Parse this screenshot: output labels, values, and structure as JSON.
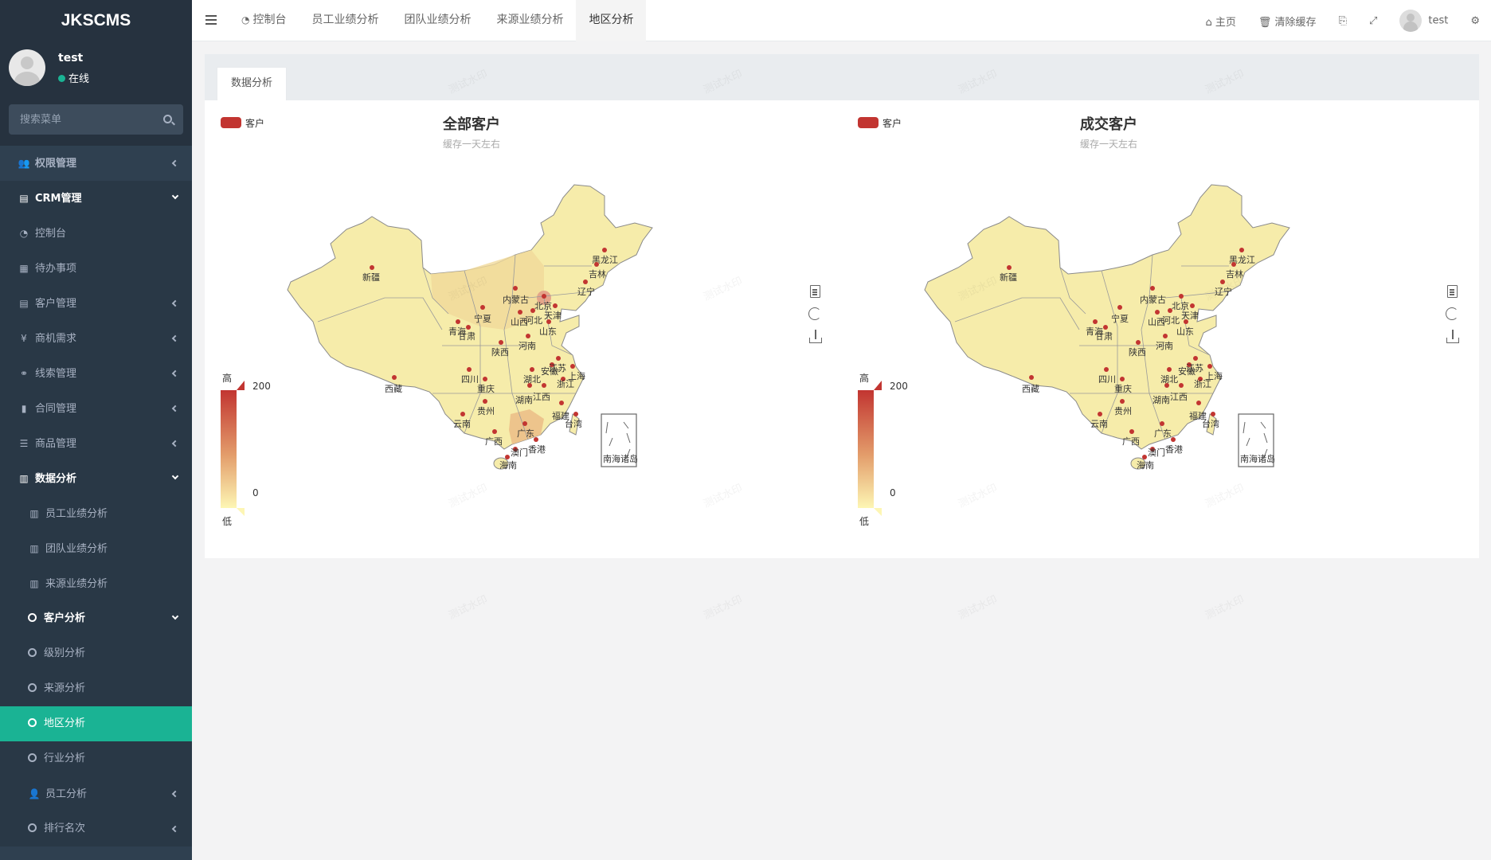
{
  "sidebar": {
    "brand": "JKSCMS",
    "user": {
      "name": "test",
      "status": "在线"
    },
    "search_placeholder": "搜索菜单",
    "items": [
      {
        "label": "权限管理",
        "icon": "users-icon",
        "glyph": "👥",
        "arrow": "left",
        "type": "top"
      },
      {
        "label": "CRM管理",
        "icon": "id-card-icon",
        "glyph": "▤",
        "arrow": "down",
        "type": "open"
      },
      {
        "label": "控制台",
        "icon": "dashboard-icon",
        "glyph": "◔",
        "arrow": "",
        "type": "sub"
      },
      {
        "label": "待办事项",
        "icon": "calendar-check-icon",
        "glyph": "▦",
        "arrow": "",
        "type": "sub"
      },
      {
        "label": "客户管理",
        "icon": "address-card-icon",
        "glyph": "▤",
        "arrow": "left",
        "type": "sub"
      },
      {
        "label": "商机需求",
        "icon": "yen-icon",
        "glyph": "¥",
        "arrow": "left",
        "type": "sub"
      },
      {
        "label": "线索管理",
        "icon": "link-icon",
        "glyph": "⚭",
        "arrow": "left",
        "type": "sub"
      },
      {
        "label": "合同管理",
        "icon": "bookmark-icon",
        "glyph": "▮",
        "arrow": "left",
        "type": "sub"
      },
      {
        "label": "商品管理",
        "icon": "list-icon",
        "glyph": "☰",
        "arrow": "left",
        "type": "sub"
      },
      {
        "label": "数据分析",
        "icon": "bar-chart-icon",
        "glyph": "▥",
        "arrow": "down",
        "type": "sub-white"
      },
      {
        "label": "员工业绩分析",
        "icon": "bar-chart-icon",
        "glyph": "▥",
        "arrow": "",
        "type": "sub2"
      },
      {
        "label": "团队业绩分析",
        "icon": "bar-chart-icon",
        "glyph": "▥",
        "arrow": "",
        "type": "sub2"
      },
      {
        "label": "来源业绩分析",
        "icon": "bar-chart-icon",
        "glyph": "▥",
        "arrow": "",
        "type": "sub2"
      },
      {
        "label": "客户分析",
        "icon": "circle-icon",
        "glyph": "",
        "arrow": "down",
        "type": "sub2-white"
      },
      {
        "label": "级别分析",
        "icon": "circle-icon",
        "glyph": "",
        "arrow": "",
        "type": "sub2"
      },
      {
        "label": "来源分析",
        "icon": "circle-icon",
        "glyph": "",
        "arrow": "",
        "type": "sub2"
      },
      {
        "label": "地区分析",
        "icon": "circle-icon",
        "glyph": "",
        "arrow": "",
        "type": "sub2-active"
      },
      {
        "label": "行业分析",
        "icon": "circle-icon",
        "glyph": "",
        "arrow": "",
        "type": "sub2"
      },
      {
        "label": "员工分析",
        "icon": "user-icon",
        "glyph": "👤",
        "arrow": "left",
        "type": "sub2"
      },
      {
        "label": "排行名次",
        "icon": "circle-icon",
        "glyph": "",
        "arrow": "left",
        "type": "sub2"
      }
    ]
  },
  "topbar": {
    "tabs": [
      {
        "label": "控制台",
        "icon": "dashboard-icon",
        "active": false
      },
      {
        "label": "员工业绩分析",
        "active": false
      },
      {
        "label": "团队业绩分析",
        "active": false
      },
      {
        "label": "来源业绩分析",
        "active": false
      },
      {
        "label": "地区分析",
        "active": true
      }
    ],
    "home": "主页",
    "clear_cache": "清除缓存",
    "user": "test"
  },
  "panel": {
    "tab": "数据分析"
  },
  "watermark": "测试水印",
  "chart_data": [
    {
      "type": "map",
      "title": "全部客户",
      "subtitle": "缓存一天左右",
      "legend": "客户",
      "visual_map": {
        "min": 0,
        "max": 200,
        "high_label": "高",
        "low_label": "低",
        "colors": [
          "#fdf6b4",
          "#e39d6b",
          "#c23531"
        ]
      },
      "inset_label": "南海诸岛",
      "regions": [
        "新疆",
        "西藏",
        "青海",
        "甘肃",
        "宁夏",
        "内蒙古",
        "黑龙江",
        "吉林",
        "辽宁",
        "北京",
        "天津",
        "河北",
        "山西",
        "陕西",
        "山东",
        "河南",
        "四川",
        "重庆",
        "湖北",
        "安徽",
        "江苏",
        "上海",
        "浙江",
        "湖南",
        "江西",
        "福建",
        "台湾",
        "贵州",
        "云南",
        "广西",
        "广东",
        "澳门",
        "香港",
        "海南"
      ]
    },
    {
      "type": "map",
      "title": "成交客户",
      "subtitle": "缓存一天左右",
      "legend": "客户",
      "visual_map": {
        "min": 0,
        "max": 200,
        "high_label": "高",
        "low_label": "低",
        "colors": [
          "#fdf6b4",
          "#e39d6b",
          "#c23531"
        ]
      },
      "inset_label": "南海诸岛",
      "regions": [
        "新疆",
        "西藏",
        "青海",
        "甘肃",
        "宁夏",
        "内蒙古",
        "黑龙江",
        "吉林",
        "辽宁",
        "北京",
        "天津",
        "河北",
        "山西",
        "陕西",
        "山东",
        "河南",
        "四川",
        "重庆",
        "湖北",
        "安徽",
        "江苏",
        "上海",
        "浙江",
        "湖南",
        "江西",
        "福建",
        "台湾",
        "贵州",
        "云南",
        "广西",
        "广东",
        "澳门",
        "香港",
        "海南"
      ]
    }
  ]
}
